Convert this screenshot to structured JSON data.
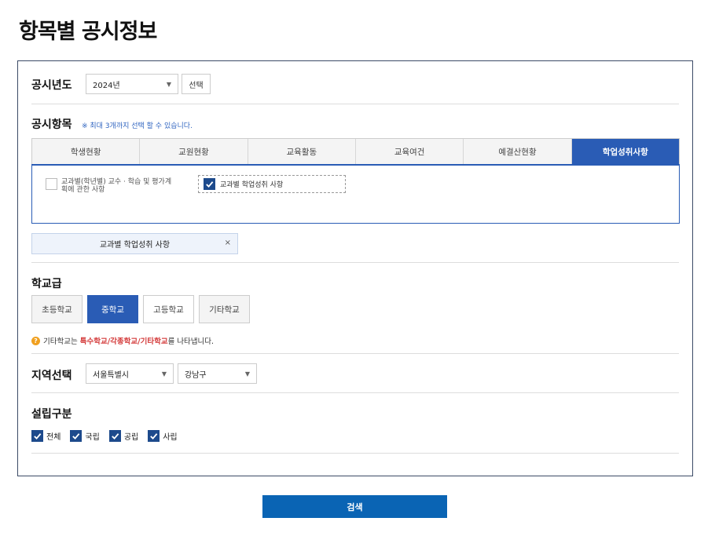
{
  "page_title": "항목별 공시정보",
  "year": {
    "label": "공시년도",
    "selected": "2024년",
    "select_button": "선택"
  },
  "items": {
    "label": "공시항목",
    "note": "※ 최대 3개까지 선택 할 수 있습니다.",
    "tabs": [
      "학생현황",
      "교원현황",
      "교육활동",
      "교육여건",
      "예결산현황",
      "학업성취사항"
    ],
    "active_tab": "학업성취사항",
    "options": [
      {
        "text_line1": "교과별(학년별) 교수 · 학습 및 평가계",
        "text_line2": "획에 관한 사항",
        "checked": false
      },
      {
        "text": "교과별 학업성취 사항",
        "checked": true
      }
    ],
    "selected_chip": "교과별 학업성취 사항",
    "chip_remove": "×"
  },
  "school_level": {
    "label": "학교급",
    "buttons": [
      "초등학교",
      "중학교",
      "고등학교",
      "기타학교"
    ],
    "active": "중학교",
    "info_prefix": "기타학교는 ",
    "info_highlight": "특수학교/각종학교/기타학교",
    "info_suffix": "를 나타냅니다.",
    "info_icon": "?"
  },
  "region": {
    "label": "지역선택",
    "city": "서울특별시",
    "district": "강남구"
  },
  "establishment": {
    "label": "설립구분",
    "options": [
      {
        "text": "전체",
        "checked": true
      },
      {
        "text": "국립",
        "checked": true
      },
      {
        "text": "공립",
        "checked": true
      },
      {
        "text": "사립",
        "checked": true
      }
    ]
  },
  "search_button": "검색",
  "colors": {
    "accent": "#2a5cb5",
    "search": "#0a64b4",
    "check": "#1d4a8c",
    "highlight_red": "#d43c3c"
  }
}
